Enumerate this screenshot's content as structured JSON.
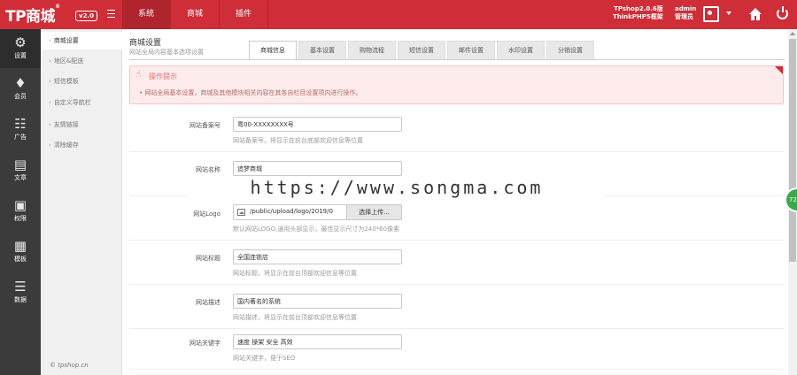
{
  "header": {
    "logo": "TP商城",
    "logo_mark": "®",
    "version": "v2.0",
    "nav": [
      {
        "label": "系统",
        "active": true
      },
      {
        "label": "商城",
        "active": false
      },
      {
        "label": "插件",
        "active": false
      }
    ],
    "sys_line1": "TPshop2.0.6版",
    "sys_line2": "ThinkPHP5框架",
    "admin_name": "admin",
    "admin_role": "管理员"
  },
  "sidebar": {
    "items": [
      {
        "label": "设置",
        "icon": "gear-icon",
        "glyph": "⚙",
        "active": true
      },
      {
        "label": "会员",
        "icon": "diamond-icon",
        "glyph": "♦",
        "active": false
      },
      {
        "label": "广告",
        "icon": "sitemap-icon",
        "glyph": "☷",
        "active": false
      },
      {
        "label": "文章",
        "icon": "document-icon",
        "glyph": "▤",
        "active": false
      },
      {
        "label": "权限",
        "icon": "lock-icon",
        "glyph": "▣",
        "active": false
      },
      {
        "label": "模板",
        "icon": "grid-icon",
        "glyph": "▦",
        "active": false
      },
      {
        "label": "数据",
        "icon": "database-icon",
        "glyph": "☰",
        "active": false
      }
    ]
  },
  "submenu": {
    "items": [
      {
        "label": "商城设置",
        "active": true
      },
      {
        "label": "地区&配送",
        "active": false
      },
      {
        "label": "短信模板",
        "active": false
      },
      {
        "label": "自定义导航栏",
        "active": false
      },
      {
        "label": "友情链接",
        "active": false
      },
      {
        "label": "清除缓存",
        "active": false
      }
    ],
    "copyright": "© tpshop.cn"
  },
  "main": {
    "title": "商城设置",
    "subtitle": "网站全局内容基本选项设置",
    "tabs": [
      {
        "label": "商城信息",
        "active": true
      },
      {
        "label": "基本设置",
        "active": false
      },
      {
        "label": "购物流程",
        "active": false
      },
      {
        "label": "短信设置",
        "active": false
      },
      {
        "label": "邮件设置",
        "active": false
      },
      {
        "label": "水印设置",
        "active": false
      },
      {
        "label": "分销设置",
        "active": false
      }
    ],
    "alert": {
      "title": "操作提示",
      "text": "• 网站全局基本设置，商城及其他模块相关内容在其各自栏目设置项内进行操作。"
    },
    "form": {
      "record": {
        "label": "网站备案号",
        "value": "粤00-XXXXXXXX号",
        "hint": "网站备案号，将显示在前台底部欢迎信息等位置"
      },
      "name": {
        "label": "网站名称",
        "value": "追梦商城"
      },
      "logo": {
        "label": "网站Logo",
        "path": "/public/upload/logo/2019/0",
        "button": "选择上传...",
        "hint": "默认网站LOGO,通用头部显示，最佳显示尺寸为240*60像素"
      },
      "title": {
        "label": "网站标题",
        "value": "全国连锁店",
        "hint": "网站标题，将显示在前台顶部欢迎信息等位置"
      },
      "desc": {
        "label": "网站描述",
        "value": "国内著名的系统",
        "hint": "网站描述，将显示在前台顶部欢迎信息等位置"
      },
      "keywords": {
        "label": "网站关键字",
        "value": "速度 操架 安全 高效",
        "hint": "网站关键字，便于SEO"
      }
    }
  },
  "float_badge": "72",
  "watermark": "https://www.songma.com"
}
